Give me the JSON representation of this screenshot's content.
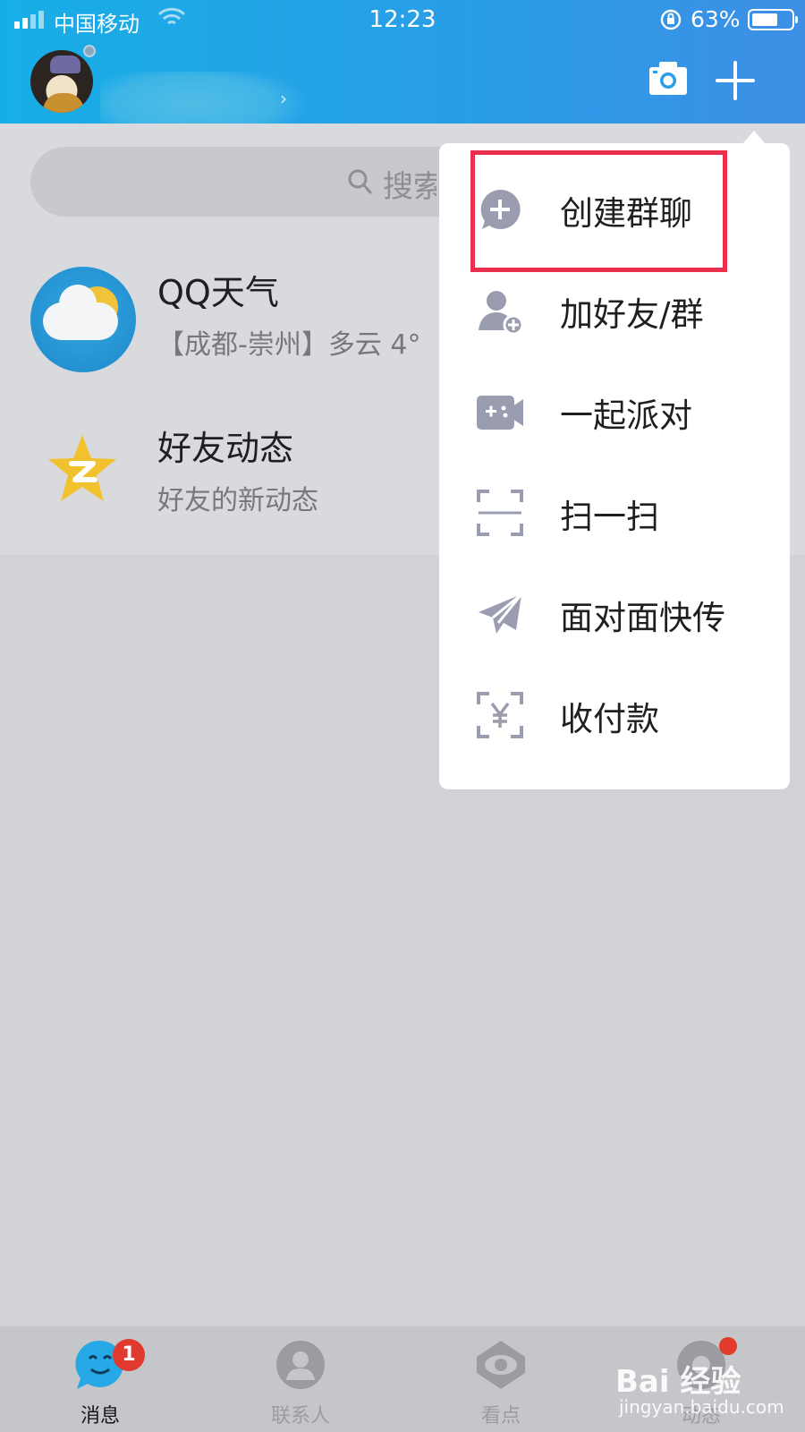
{
  "status_bar": {
    "carrier": "中国移动",
    "time": "12:23",
    "battery_percent": "63%",
    "battery_level": 0.63
  },
  "header": {
    "name_chevron": "›",
    "camera_icon": "camera-icon",
    "plus_icon": "plus-icon"
  },
  "search": {
    "placeholder": "搜索"
  },
  "conversations": [
    {
      "title": "QQ天气",
      "subtitle": "【成都-崇州】多云 4°",
      "icon": "weather-cloud-icon"
    },
    {
      "title": "好友动态",
      "subtitle": "好友的新动态",
      "icon": "qzone-star-icon"
    }
  ],
  "menu": {
    "items": [
      {
        "label": "创建群聊",
        "icon": "create-group-chat-icon",
        "highlighted": true
      },
      {
        "label": "加好友/群",
        "icon": "add-friend-icon"
      },
      {
        "label": "一起派对",
        "icon": "party-game-icon"
      },
      {
        "label": "扫一扫",
        "icon": "scan-icon"
      },
      {
        "label": "面对面快传",
        "icon": "paper-plane-icon"
      },
      {
        "label": "收付款",
        "icon": "payment-scan-icon"
      }
    ]
  },
  "tabs": [
    {
      "label": "消息",
      "icon": "message-icon",
      "active": true,
      "badge": "1"
    },
    {
      "label": "联系人",
      "icon": "contacts-icon",
      "active": false
    },
    {
      "label": "看点",
      "icon": "eye-icon",
      "active": false
    },
    {
      "label": "动态",
      "icon": "dynamic-icon",
      "active": false,
      "dot": true
    }
  ],
  "watermark": {
    "brand": "Bai 经验",
    "url": "jingyan.baidu.com"
  },
  "colors": {
    "header_start": "#17aee6",
    "header_end": "#3d8fe6",
    "highlight_border": "#ec2f4d",
    "menu_icon": "#9a9cb0",
    "badge": "#e03a2e"
  }
}
